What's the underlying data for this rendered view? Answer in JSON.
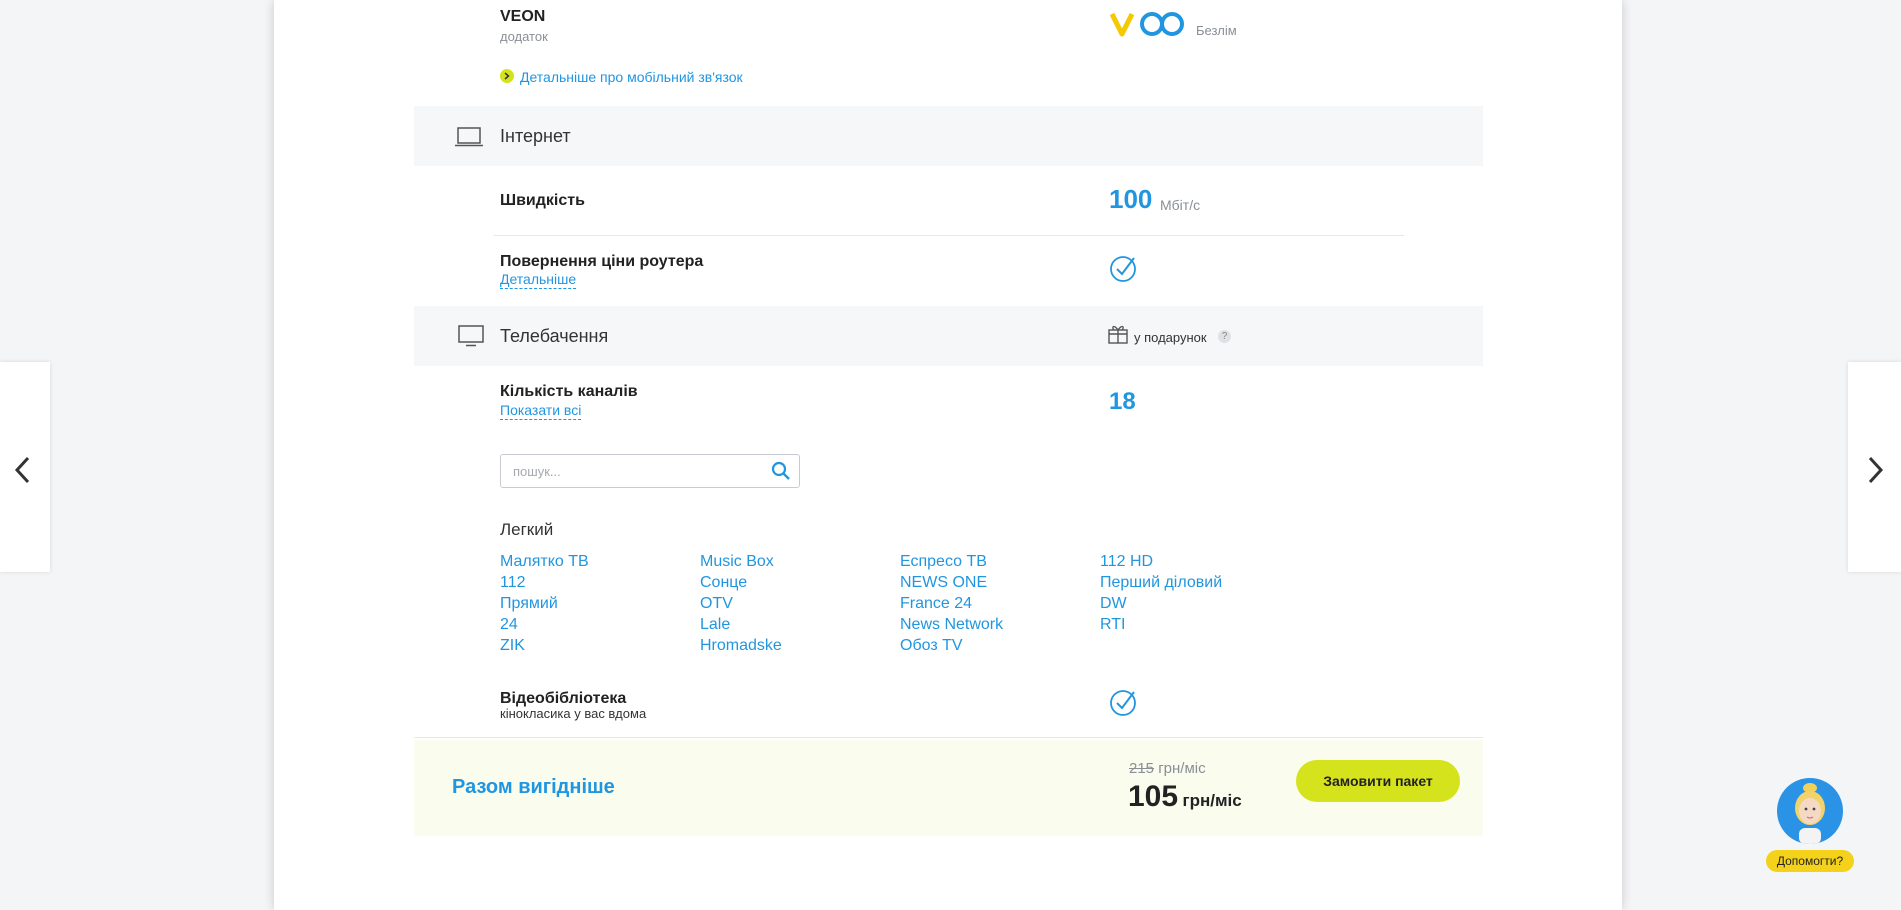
{
  "addon": {
    "name": "VEON",
    "subtitle": "додаток",
    "value_label": "Безлім",
    "more_link": "Детальніше про мобільний зв'язок"
  },
  "internet": {
    "section_title": "Інтернет",
    "speed_label": "Швидкість",
    "speed_value": "100",
    "speed_unit": "Мбіт/с",
    "router_label": "Повернення ціни роутера",
    "router_link": "Детальніше"
  },
  "tv": {
    "section_title": "Телебачення",
    "gift_label": "у подарунок",
    "gift_help": "?",
    "channels_label": "Кількість каналів",
    "channels_link": "Показати всі",
    "channels_count": "18",
    "search_placeholder": "пошук...",
    "package_name": "Легкий",
    "channels": [
      [
        "Малятко TB",
        "112",
        "Прямий",
        "24",
        "ZIK"
      ],
      [
        "Music Box",
        "Сонце",
        "OTV",
        "Lale",
        "Hromadske"
      ],
      [
        "Еспресо TB",
        "NEWS ONE",
        "France 24",
        "News Network",
        "Обоз TV"
      ],
      [
        "112 HD",
        "Перший діловий",
        "DW",
        "RTI"
      ]
    ],
    "library_label": "Відеобібліотека",
    "library_subtitle": "кінокласика у вас вдома"
  },
  "footer": {
    "title": "Разом вигідніше",
    "old_price": "215",
    "old_price_unit": "грн/міс",
    "new_price": "105",
    "new_price_unit": "грн/міс",
    "order_button": "Замовити пакет"
  },
  "help": {
    "label": "Допомогти?"
  },
  "colors": {
    "accent_blue": "#2196e0",
    "accent_lime": "#d5e31c",
    "logo_yellow": "#f5c800"
  },
  "icons": {
    "prev": "chevron-left-icon",
    "next": "chevron-right-icon",
    "laptop": "laptop-icon",
    "tv": "tv-icon",
    "gift": "gift-icon",
    "check": "check-circle-icon",
    "search": "search-icon"
  }
}
